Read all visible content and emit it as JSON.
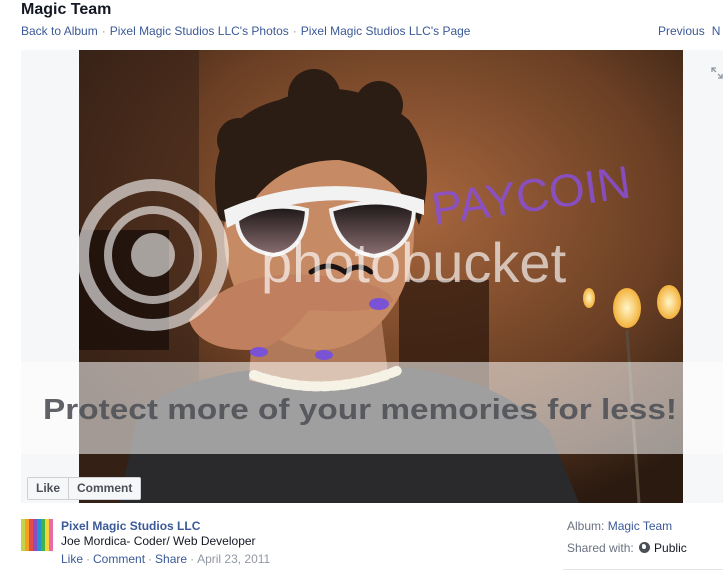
{
  "album_title": "Magic Team",
  "breadcrumbs": {
    "back": "Back to Album",
    "photos": "Pixel Magic Studios LLC's Photos",
    "page": "Pixel Magic Studios LLC's Page",
    "separator": "·"
  },
  "pager": {
    "previous": "Previous",
    "next_partial": "N"
  },
  "photo": {
    "watermark_logo": "photobucket",
    "watermark_banner": "Protect more of your memories for less!",
    "wall_writing": "PAYCOIN"
  },
  "photo_buttons": {
    "like": "Like",
    "comment": "Comment"
  },
  "post": {
    "page_name": "Pixel Magic Studios LLC",
    "caption": "Joe Mordica- Coder/ Web Developer",
    "like": "Like",
    "comment": "Comment",
    "share": "Share",
    "date": "April 23, 2011",
    "dot": "·"
  },
  "meta": {
    "album_label": "Album:",
    "album_value": "Magic Team",
    "shared_label": "Shared with:",
    "shared_value": "Public"
  },
  "colors": {
    "link": "#3b5998",
    "muted": "#9197a3",
    "stage_bg": "#f6f7f8",
    "avatar_stripes": [
      "#c3d34a",
      "#f4a21d",
      "#e34a4a",
      "#8a4fbf",
      "#2a8fd1",
      "#39b54a",
      "#f7d23a",
      "#e86aa6"
    ]
  },
  "icons": {
    "expand": "expand-icon",
    "audience": "globe-icon"
  }
}
